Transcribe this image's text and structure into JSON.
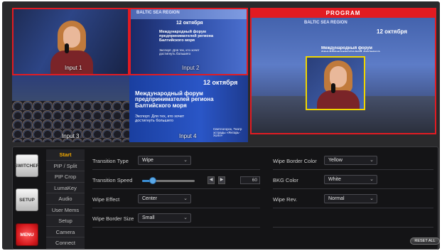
{
  "multiview": {
    "inputs": [
      {
        "label": "Input 1"
      },
      {
        "label": "Input 2"
      },
      {
        "label": "Input 3"
      },
      {
        "label": "Input 4"
      }
    ]
  },
  "program": {
    "label": "PROGRAM"
  },
  "screen_text": {
    "title": "Международный форум предпринимателей региона Балтийского моря",
    "expo": "Экспорт. Для тех, кто хочет достигнуть большего",
    "date": "12 октября",
    "venue": "Светлогорск, Театр эстрады «Янтарь-Холл»",
    "banner": "BALTIC SEA REGION"
  },
  "side_buttons": {
    "switcher": "SWITCHER",
    "setup": "SETUP",
    "menu": "MENU"
  },
  "menu": {
    "active_index": 0,
    "items": [
      {
        "label": "Start"
      },
      {
        "label": "PIP / Split"
      },
      {
        "label": "PIP Crop"
      },
      {
        "label": "LumaKey"
      },
      {
        "label": "Audio"
      },
      {
        "label": "User Mems"
      },
      {
        "label": "Setup"
      },
      {
        "label": "Camera"
      },
      {
        "label": "Connect"
      }
    ]
  },
  "settings": {
    "transition_type": {
      "label": "Transition Type",
      "value": "Wipe"
    },
    "transition_speed": {
      "label": "Transition Speed",
      "value": "60",
      "fraction": 0.2
    },
    "wipe_effect": {
      "label": "Wipe Effect",
      "value": "Center"
    },
    "wipe_border_size": {
      "label": "Wipe Border Size",
      "value": "Small"
    },
    "wipe_border_color": {
      "label": "Wipe Border Color",
      "value": "Yellow"
    },
    "bkg_color": {
      "label": "BKG Color",
      "value": "White"
    },
    "wipe_rev": {
      "label": "Wipe Rev.",
      "value": "Normal"
    }
  },
  "reset_label": "RESET ALL",
  "colors": {
    "accent_red": "#e21b22",
    "pip_border": "#f0d500",
    "menu_active": "#f2a900",
    "slider": "#3b8fd6"
  },
  "icons": {
    "dropdown": "chevron-down-icon",
    "step_left": "arrow-left-icon",
    "step_right": "arrow-right-icon"
  }
}
